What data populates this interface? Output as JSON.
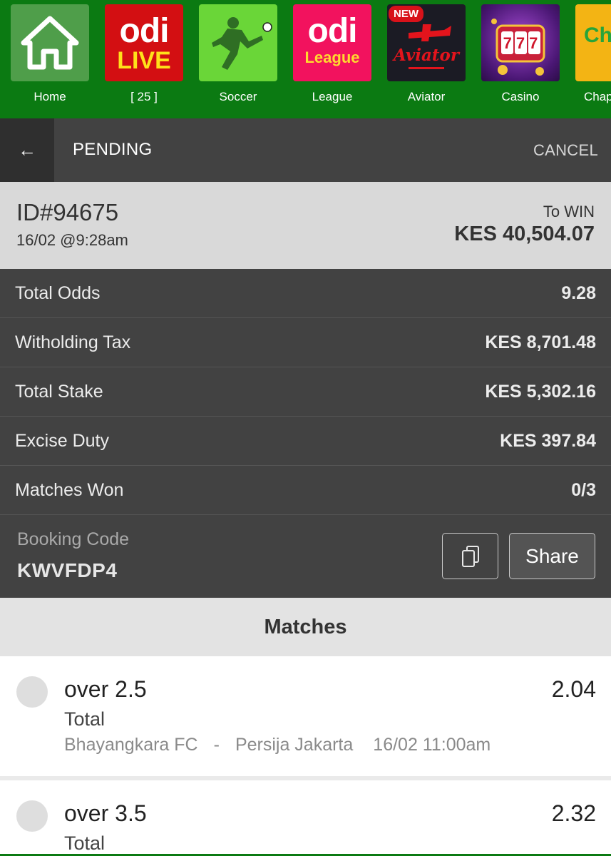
{
  "top_nav": {
    "items": [
      {
        "label": "Home",
        "icon": "home-icon"
      },
      {
        "label": "[ 25 ]",
        "icon": "odi-live-icon",
        "logo_text": "odi",
        "logo_sub": "LIVE"
      },
      {
        "label": "Soccer",
        "icon": "soccer-player-icon"
      },
      {
        "label": "League",
        "icon": "odi-league-icon",
        "logo_text": "odi",
        "logo_sub": "League"
      },
      {
        "label": "Aviator",
        "icon": "aviator-plane-icon",
        "badge": "NEW",
        "logo_sub": "Aviator"
      },
      {
        "label": "Casino",
        "icon": "slot-machine-icon",
        "logo_sub": "777"
      },
      {
        "label": "Chap",
        "icon": "chap-chap-icon",
        "logo_sub": "Ch Ch"
      }
    ]
  },
  "header": {
    "back_symbol": "←",
    "title": "PENDING",
    "cancel_label": "CANCEL"
  },
  "summary": {
    "bet_id": "ID#94675",
    "placed_at": "16/02 @9:28am",
    "to_win_label": "To WIN",
    "to_win_value": "KES 40,504.07"
  },
  "stats": [
    {
      "label": "Total Odds",
      "value": "9.28"
    },
    {
      "label": "Witholding Tax",
      "value": "KES 8,701.48"
    },
    {
      "label": "Total Stake",
      "value": "KES 5,302.16"
    },
    {
      "label": "Excise Duty",
      "value": "KES 397.84"
    },
    {
      "label": "Matches Won",
      "value": "0/3"
    }
  ],
  "booking": {
    "label": "Booking Code",
    "code": "KWVFDP4",
    "copy_icon": "copy-icon",
    "share_label": "Share"
  },
  "matches": {
    "heading": "Matches",
    "items": [
      {
        "pick": "over 2.5",
        "market": "Total",
        "odds": "2.04",
        "home": "Bhayangkara FC",
        "separator": "-",
        "away": "Persija Jakarta",
        "kickoff": "16/02 11:00am"
      },
      {
        "pick": "over 3.5",
        "market": "Total",
        "odds": "2.32"
      }
    ]
  },
  "colors": {
    "brand_green": "#0b7a12",
    "dark_panel": "#424242",
    "summary_bg": "#d9d9d9"
  }
}
